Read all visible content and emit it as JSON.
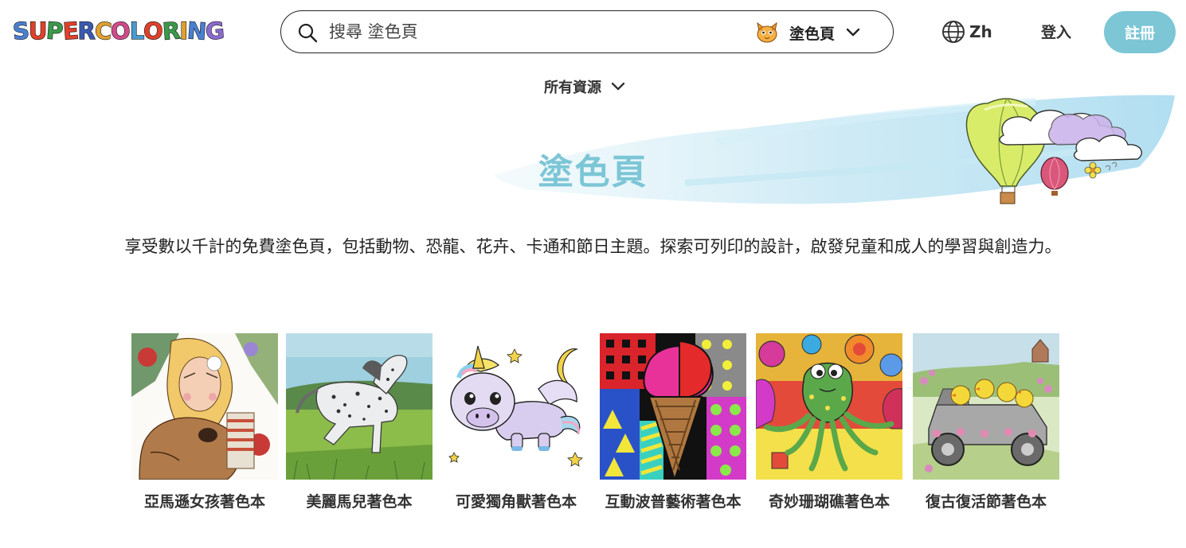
{
  "brand": {
    "logo_text": "SUPERCOLORING",
    "logo_letters": [
      "S",
      "U",
      "P",
      "E",
      "R",
      "C",
      "O",
      "L",
      "O",
      "R",
      "I",
      "N",
      "G"
    ]
  },
  "search": {
    "placeholder": "搜尋 塗色頁",
    "value": "",
    "category_label": "塗色頁",
    "category_icon": "cat-face-icon"
  },
  "header": {
    "language_label": "Zh",
    "login_label": "登入",
    "signup_label": "註冊",
    "accent_color": "#7cc6d6"
  },
  "resources": {
    "label": "所有資源"
  },
  "page": {
    "title": "塗色頁",
    "description": "享受數以千計的免費塗色頁，包括動物、恐龍、花卉、卡通和節日主題。探索可列印的設計，啟發兒童和成人的學習與創造力。"
  },
  "cards": [
    {
      "label": "亞馬遜女孩著色本"
    },
    {
      "label": "美麗馬兒著色本"
    },
    {
      "label": "可愛獨角獸著色本"
    },
    {
      "label": "互動波普藝術著色本"
    },
    {
      "label": "奇妙珊瑚礁著色本"
    },
    {
      "label": "復古復活節著色本"
    }
  ]
}
